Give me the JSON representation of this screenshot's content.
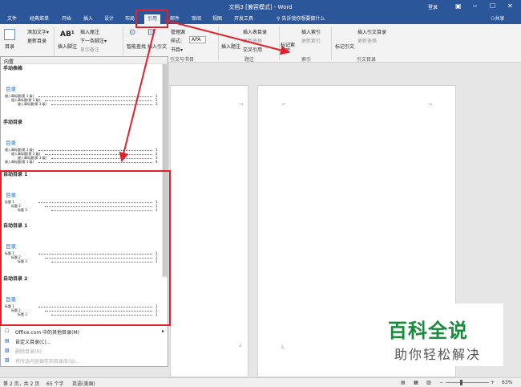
{
  "window": {
    "title": "文档3 [兼容模式] - Word",
    "login": "登录",
    "controls": {
      "ribbon_opts": "▣",
      "min": "─",
      "max": "☐",
      "close": "✕"
    }
  },
  "tabs": [
    "文件",
    "经典菜单",
    "开始",
    "插入",
    "设计",
    "布局",
    "引用",
    "邮件",
    "审阅",
    "视图",
    "开发工具"
  ],
  "tell_me": "告诉我你想要做什么",
  "share": "共享",
  "ribbon": {
    "toc": {
      "big": "目录",
      "add_text": "添加文字▾",
      "update": "更新目录"
    },
    "footnotes": {
      "insert_footnote": "插入脚注",
      "insert_endnote": "插入尾注",
      "next": "下一条脚注▾",
      "show": "显示备注"
    },
    "research": {
      "label": "智能查找"
    },
    "citations": {
      "insert": "插入引文",
      "manage": "管理源",
      "style_label": "样式:",
      "style": "APA",
      "biblio": "书目▾"
    },
    "captions": {
      "insert_caption": "插入题注",
      "table_fig": "插入表目录",
      "update_table": "更新表格",
      "cross_ref": "交叉引用"
    },
    "index": {
      "mark": "标记索引项",
      "insert": "插入索引",
      "update": "更新索引"
    },
    "toa": {
      "mark": "标记引文",
      "insert": "插入引文目录",
      "update": "更新表格"
    },
    "groups": {
      "toc": "目录",
      "footnotes": "脚注",
      "citations": "引文与书目",
      "captions": "题注",
      "index": "索引",
      "toa": "引文目录"
    }
  },
  "gallery": {
    "header": "内置",
    "items": [
      {
        "name": "手动表格",
        "title": "目录",
        "entries": [
          {
            "text": "键入章标题(第 1 级)",
            "page": "1"
          },
          {
            "text": "键入章标题(第 2 级)",
            "page": "2"
          },
          {
            "text": "键入章标题(第 3 级)",
            "page": "3"
          }
        ]
      },
      {
        "name": "手动目录",
        "title": "目录",
        "entries": [
          {
            "text": "键入章标题(第 1 级)",
            "page": "1"
          },
          {
            "text": "键入章标题(第 2 级)",
            "page": "2"
          },
          {
            "text": "键入章标题(第 3 级)",
            "page": "3"
          },
          {
            "text": "键入章标题(第 1 级)",
            "page": "4"
          }
        ]
      },
      {
        "name": "自动目录 1",
        "title": "目录",
        "entries": [
          {
            "text": "标题 1",
            "page": "1"
          },
          {
            "text": "标题 2",
            "page": "1"
          },
          {
            "text": "标题 3",
            "page": "1"
          }
        ]
      },
      {
        "name": "自动目录 1",
        "title": "目录",
        "entries": [
          {
            "text": "标题 1",
            "page": "1"
          },
          {
            "text": "标题 2",
            "page": "1"
          },
          {
            "text": "标题 3",
            "page": "1"
          }
        ]
      },
      {
        "name": "自动目录 2",
        "title": "目录",
        "entries": [
          {
            "text": "标题 1",
            "page": "1"
          },
          {
            "text": "标题 2",
            "page": "1"
          },
          {
            "text": "标题 3",
            "page": "1"
          }
        ]
      }
    ]
  },
  "gallery_menu": [
    {
      "label": "Office.com 中的其他目录(M)",
      "enabled": true,
      "arrow": "▸",
      "icon": "☐"
    },
    {
      "label": "自定义目录(C)...",
      "enabled": true,
      "icon": "▤"
    },
    {
      "label": "删除目录(R)",
      "enabled": false,
      "icon": "▨"
    },
    {
      "label": "将所选内容保存到目录库(S)...",
      "enabled": false,
      "icon": "▧"
    }
  ],
  "status": {
    "page": "第 2 页，共 2 页",
    "words": "65 个字",
    "lang": "英语(美国)",
    "zoom": "63%",
    "zoom_minus": "−",
    "zoom_plus": "+"
  },
  "watermark": {
    "brand": "百科全说",
    "slogan": "助你轻松解决"
  },
  "icons": {
    "lightbulb": "lightbulb-icon",
    "person": "person-icon",
    "toc": "toc-icon"
  },
  "colors": {
    "title_bar": "#2b579a",
    "annotation": "#e0202a",
    "watermark_green": "#1a8a3c",
    "toc_heading": "#2e74b5"
  }
}
